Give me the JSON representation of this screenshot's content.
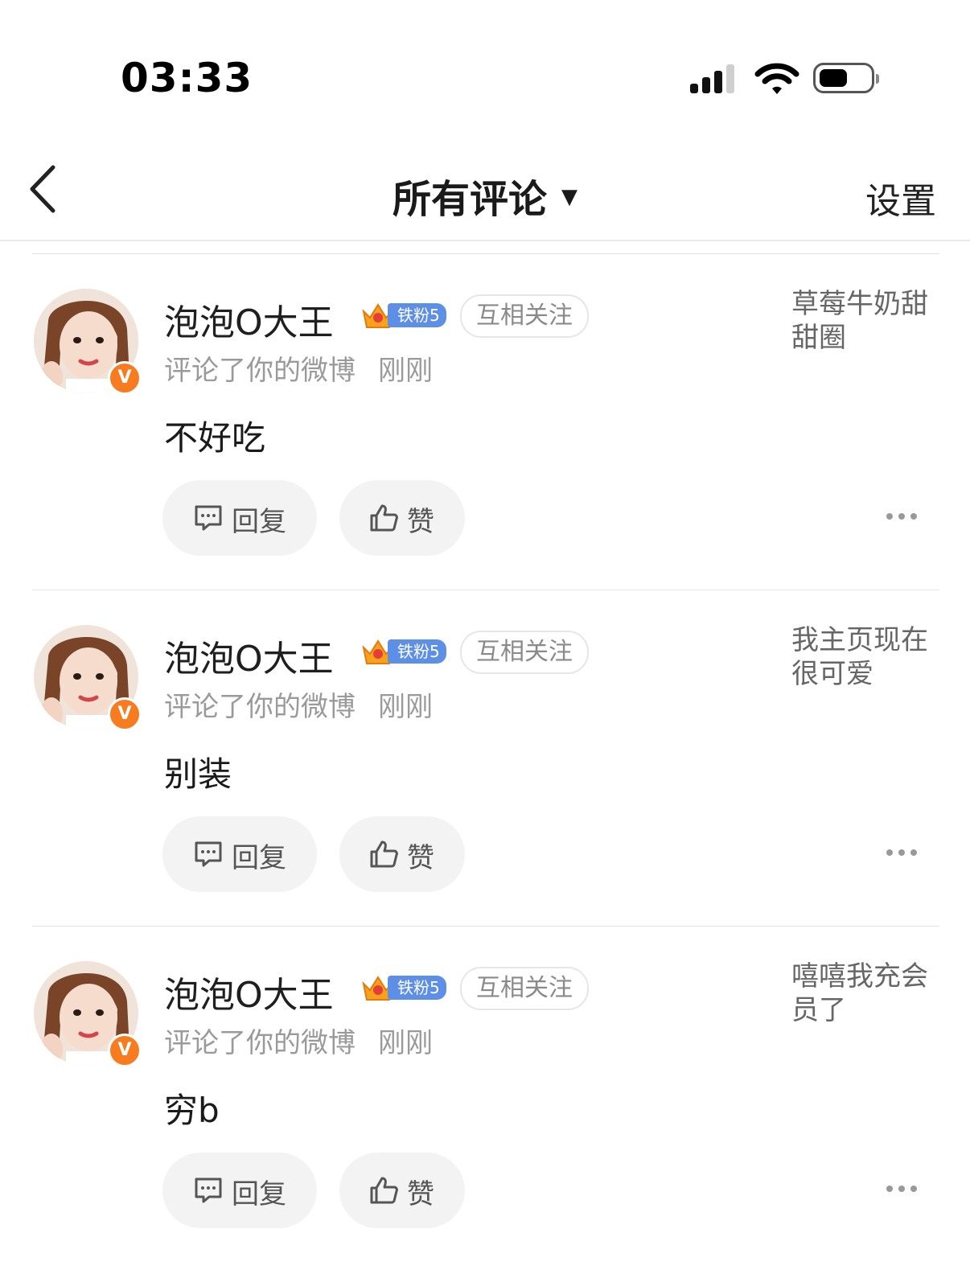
{
  "status_bar": {
    "time": "03:33"
  },
  "header": {
    "title": "所有评论",
    "caret": "▼",
    "settings_label": "设置"
  },
  "comments": [
    {
      "username": "泡泡O大王",
      "fan_badge": "铁粉5",
      "mutual_label": "互相关注",
      "action": "评论了你的微博",
      "time": "刚刚",
      "content": "不好吃",
      "post_ref": "草莓牛奶甜甜圈",
      "verified": "V",
      "reply_label": "回复",
      "like_label": "赞"
    },
    {
      "username": "泡泡O大王",
      "fan_badge": "铁粉5",
      "mutual_label": "互相关注",
      "action": "评论了你的微博",
      "time": "刚刚",
      "content": "别装",
      "post_ref": "我主页现在很可爱",
      "verified": "V",
      "reply_label": "回复",
      "like_label": "赞"
    },
    {
      "username": "泡泡O大王",
      "fan_badge": "铁粉5",
      "mutual_label": "互相关注",
      "action": "评论了你的微博",
      "time": "刚刚",
      "content": "穷b",
      "post_ref": "嘻嘻我充会员了",
      "verified": "V",
      "reply_label": "回复",
      "like_label": "赞"
    }
  ],
  "colors": {
    "verified_badge": "#f77b1f",
    "fan_badge": "#5e8fe6",
    "secondary_text": "#9a9a9a"
  }
}
